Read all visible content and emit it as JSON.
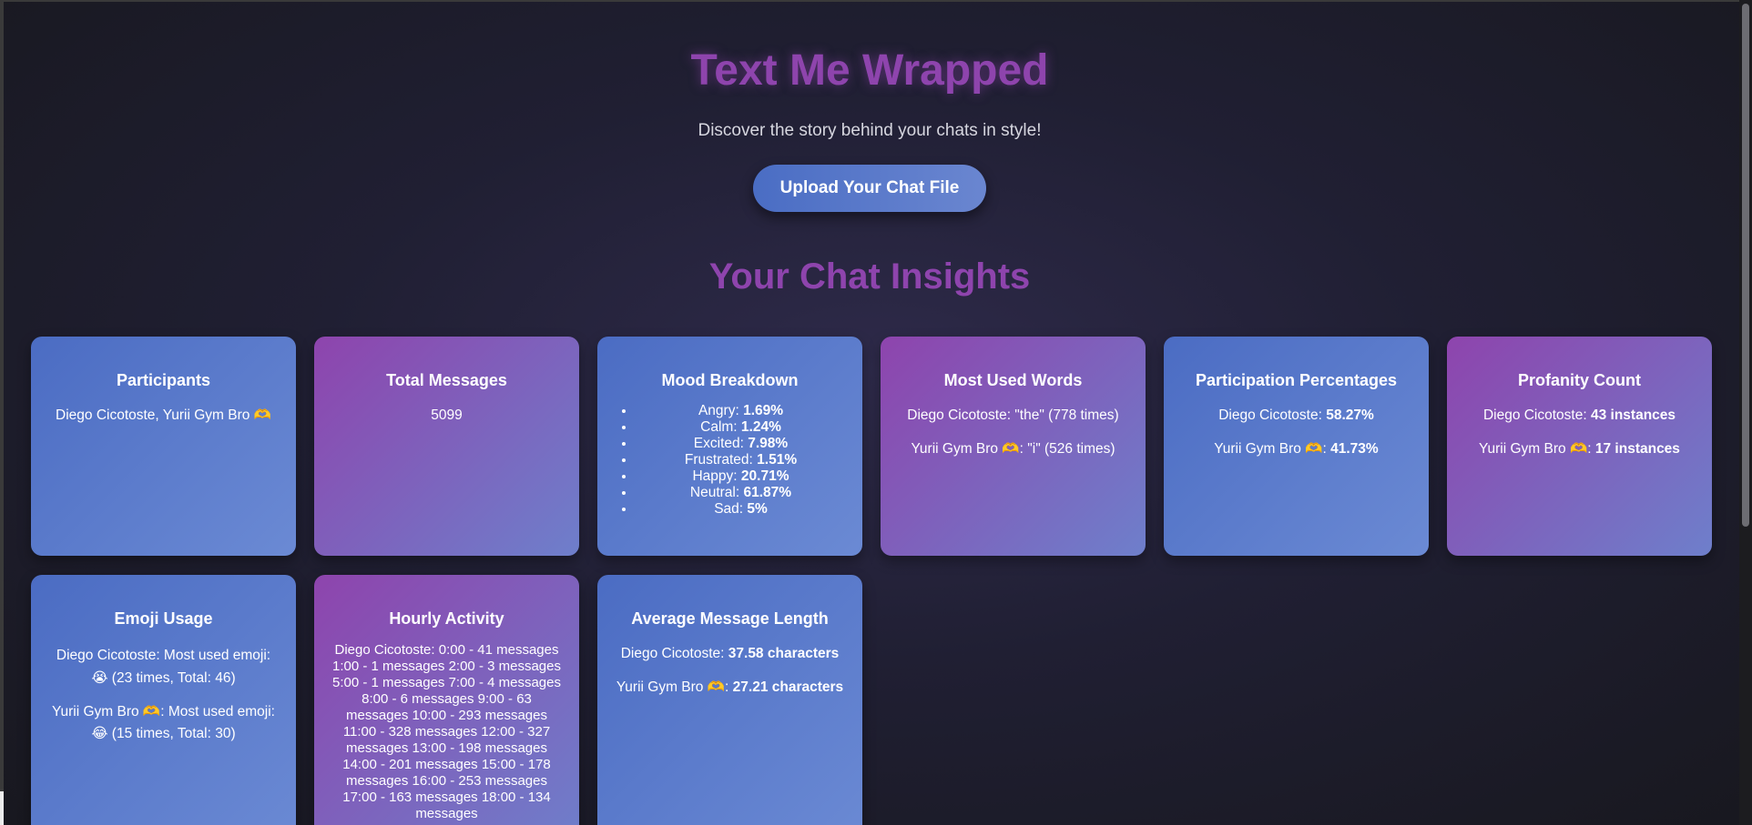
{
  "header": {
    "title": "Text Me Wrapped",
    "tagline": "Discover the story behind your chats in style!",
    "upload_label": "Upload Your Chat File"
  },
  "insights_title": "Your Chat Insights",
  "cards": {
    "participants": {
      "title": "Participants",
      "text": "Diego Cicotoste, Yurii Gym Bro 🫶"
    },
    "total_messages": {
      "title": "Total Messages",
      "value": "5099"
    },
    "mood": {
      "title": "Mood Breakdown",
      "items": [
        {
          "label": "Angry:",
          "value": "1.69%"
        },
        {
          "label": "Calm:",
          "value": "1.24%"
        },
        {
          "label": "Excited:",
          "value": "7.98%"
        },
        {
          "label": "Frustrated:",
          "value": "1.51%"
        },
        {
          "label": "Happy:",
          "value": "20.71%"
        },
        {
          "label": "Neutral:",
          "value": "61.87%"
        },
        {
          "label": "Sad:",
          "value": "5%"
        }
      ]
    },
    "words": {
      "title": "Most Used Words",
      "lines": [
        "Diego Cicotoste: \"the\" (778 times)",
        "Yurii Gym Bro 🫶: \"i\" (526 times)"
      ]
    },
    "participation": {
      "title": "Participation Percentages",
      "lines": [
        {
          "label": "Diego Cicotoste:",
          "value": "58.27%"
        },
        {
          "label": "Yurii Gym Bro 🫶:",
          "value": "41.73%"
        }
      ]
    },
    "profanity": {
      "title": "Profanity Count",
      "lines": [
        {
          "label": "Diego Cicotoste:",
          "value": "43 instances"
        },
        {
          "label": "Yurii Gym Bro 🫶:",
          "value": "17 instances"
        }
      ]
    },
    "emoji": {
      "title": "Emoji Usage",
      "lines": [
        "Diego Cicotoste: Most used emoji: 😭 (23 times, Total: 46)",
        "Yurii Gym Bro 🫶: Most used emoji: 😂 (15 times, Total: 30)"
      ]
    },
    "hourly": {
      "title": "Hourly Activity",
      "text": "Diego Cicotoste: 0:00 - 41 messages 1:00 - 1 messages 2:00 - 3 messages 5:00 - 1 messages 7:00 - 4 messages 8:00 - 6 messages 9:00 - 63 messages 10:00 - 293 messages 11:00 - 328 messages 12:00 - 327 messages 13:00 - 198 messages 14:00 - 201 messages 15:00 - 178 messages 16:00 - 253 messages 17:00 - 163 messages 18:00 - 134 messages"
    },
    "avg_length": {
      "title": "Average Message Length",
      "lines": [
        {
          "label": "Diego Cicotoste:",
          "value": "37.58 characters"
        },
        {
          "label": "Yurii Gym Bro 🫶:",
          "value": "27.21 characters"
        }
      ]
    }
  }
}
